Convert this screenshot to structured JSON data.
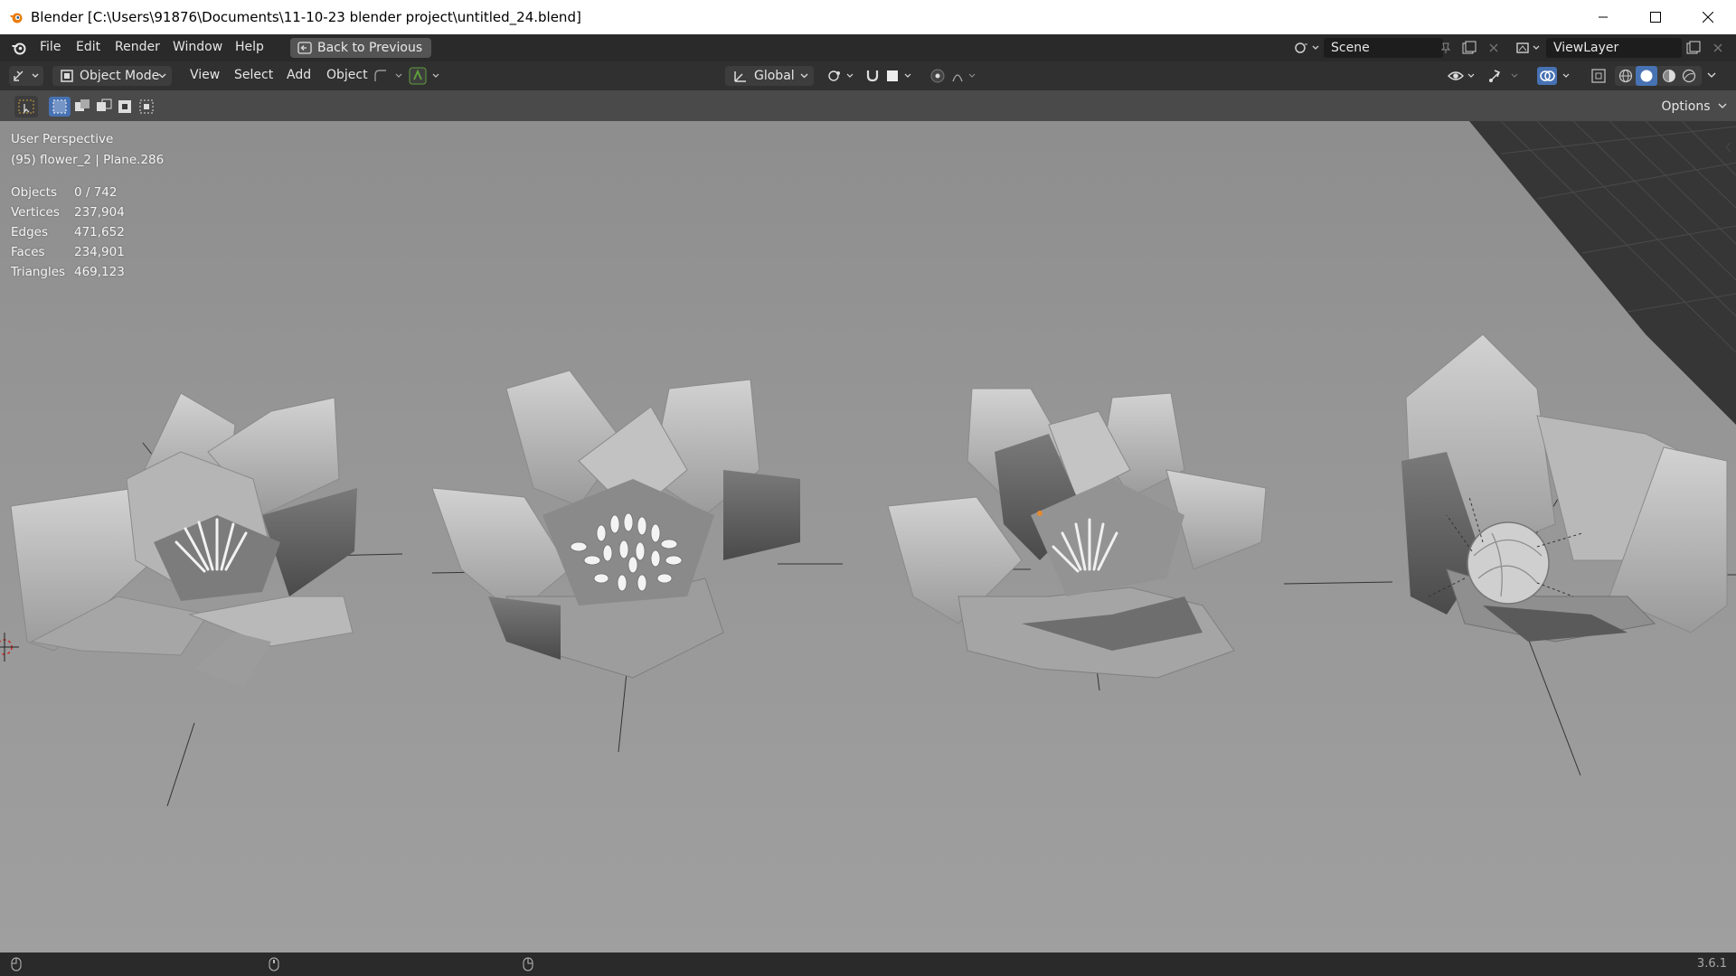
{
  "window": {
    "title": "Blender [C:\\Users\\91876\\Documents\\11-10-23 blender project\\untitled_24.blend]"
  },
  "menu": {
    "items": [
      "File",
      "Edit",
      "Render",
      "Window",
      "Help"
    ],
    "back_button": "Back to Previous"
  },
  "scene": {
    "name": "Scene",
    "view_layer": "ViewLayer"
  },
  "viewport_header": {
    "mode": "Object Mode",
    "menus": [
      "View",
      "Select",
      "Add",
      "Object"
    ],
    "transform_orientation": "Global",
    "options_label": "Options"
  },
  "viewport": {
    "perspective": "User Perspective",
    "active": "(95) flower_2 | Plane.286",
    "stats": [
      {
        "label": "Objects",
        "value": "0 / 742"
      },
      {
        "label": "Vertices",
        "value": "237,904"
      },
      {
        "label": "Edges",
        "value": "471,652"
      },
      {
        "label": "Faces",
        "value": "234,901"
      },
      {
        "label": "Triangles",
        "value": "469,123"
      }
    ]
  },
  "status": {
    "version": "3.6.1"
  },
  "colors": {
    "accent": "#4772b3",
    "snap_green": "#5e9e3b",
    "origin_orange": "#e68a2e"
  }
}
